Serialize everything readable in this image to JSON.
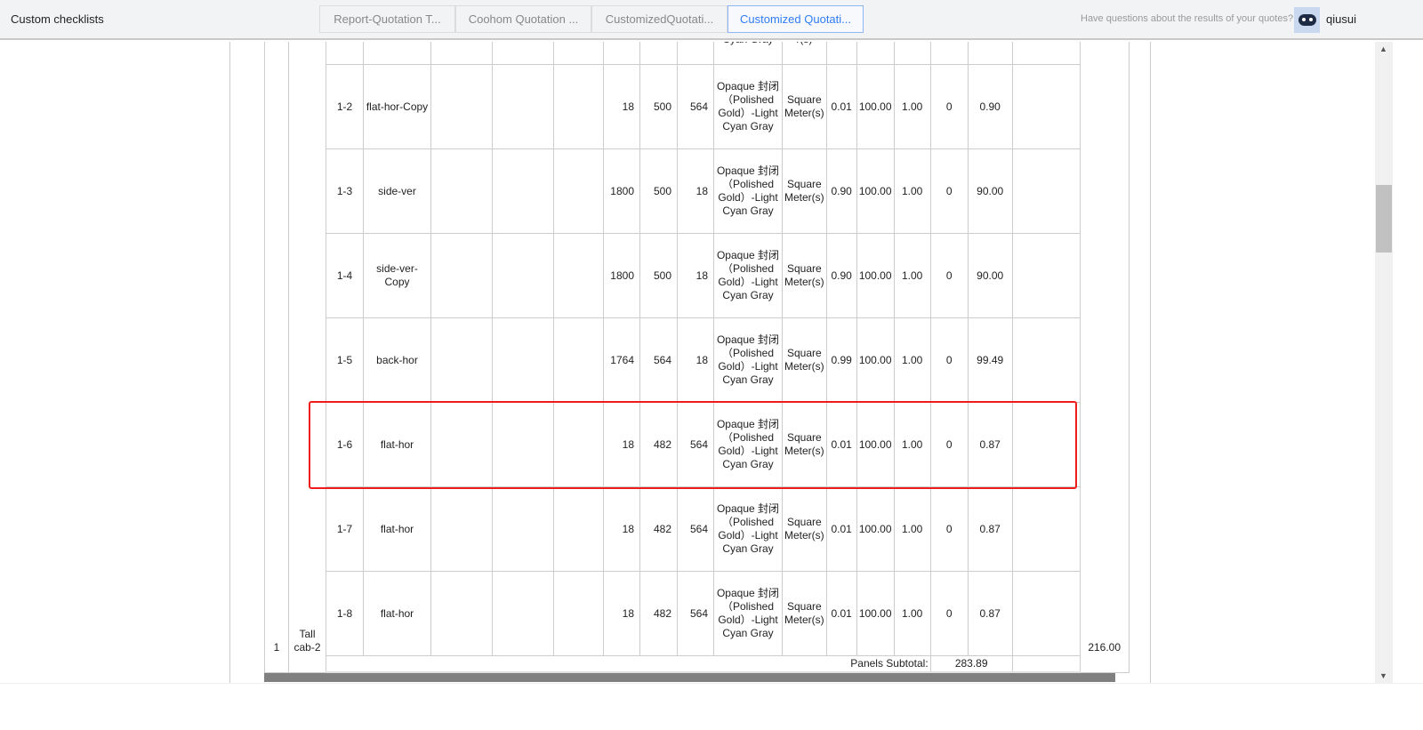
{
  "header": {
    "title": "Custom checklists",
    "tabs": [
      "Report-Quotation T...",
      "Coohom Quotation ...",
      "CustomizedQuotati...",
      "Customized Quotati..."
    ],
    "active_tab": 3,
    "help_text": "Have questions about the results of your quotes?",
    "username": "qiusui"
  },
  "table": {
    "index": "1",
    "cabinet": "Tall cab-2",
    "cabinet_total": "216.00",
    "partial_row": {
      "material": "Cyan Gray",
      "unit": "r(s)"
    },
    "rows": [
      {
        "code": "1-2",
        "name": "flat-hor-Copy",
        "l": "18",
        "w": "500",
        "t": "564",
        "material": "Opaque 封闭（Polished Gold）-Light Cyan Gray",
        "unit": "Square Meter(s)",
        "qty": "0.01",
        "price": "100.00",
        "coef": "1.00",
        "extra": "0",
        "amount": "0.90"
      },
      {
        "code": "1-3",
        "name": "side-ver",
        "l": "1800",
        "w": "500",
        "t": "18",
        "material": "Opaque 封闭（Polished Gold）-Light Cyan Gray",
        "unit": "Square Meter(s)",
        "qty": "0.90",
        "price": "100.00",
        "coef": "1.00",
        "extra": "0",
        "amount": "90.00"
      },
      {
        "code": "1-4",
        "name": "side-ver-Copy",
        "l": "1800",
        "w": "500",
        "t": "18",
        "material": "Opaque 封闭（Polished Gold）-Light Cyan Gray",
        "unit": "Square Meter(s)",
        "qty": "0.90",
        "price": "100.00",
        "coef": "1.00",
        "extra": "0",
        "amount": "90.00"
      },
      {
        "code": "1-5",
        "name": "back-hor",
        "l": "1764",
        "w": "564",
        "t": "18",
        "material": "Opaque 封闭（Polished Gold）-Light Cyan Gray",
        "unit": "Square Meter(s)",
        "qty": "0.99",
        "price": "100.00",
        "coef": "1.00",
        "extra": "0",
        "amount": "99.49"
      },
      {
        "code": "1-6",
        "name": "flat-hor",
        "l": "18",
        "w": "482",
        "t": "564",
        "material": "Opaque 封闭（Polished Gold）-Light Cyan Gray",
        "unit": "Square Meter(s)",
        "qty": "0.01",
        "price": "100.00",
        "coef": "1.00",
        "extra": "0",
        "amount": "0.87"
      },
      {
        "code": "1-7",
        "name": "flat-hor",
        "l": "18",
        "w": "482",
        "t": "564",
        "material": "Opaque 封闭（Polished Gold）-Light Cyan Gray",
        "unit": "Square Meter(s)",
        "qty": "0.01",
        "price": "100.00",
        "coef": "1.00",
        "extra": "0",
        "amount": "0.87"
      },
      {
        "code": "1-8",
        "name": "flat-hor",
        "l": "18",
        "w": "482",
        "t": "564",
        "material": "Opaque 封闭（Polished Gold）-Light Cyan Gray",
        "unit": "Square Meter(s)",
        "qty": "0.01",
        "price": "100.00",
        "coef": "1.00",
        "extra": "0",
        "amount": "0.87"
      }
    ],
    "subtotal_label": "Panels Subtotal:",
    "subtotal_value": "283.89"
  },
  "colors": {
    "accent": "#2f7df6",
    "highlight": "#f01c1c"
  }
}
